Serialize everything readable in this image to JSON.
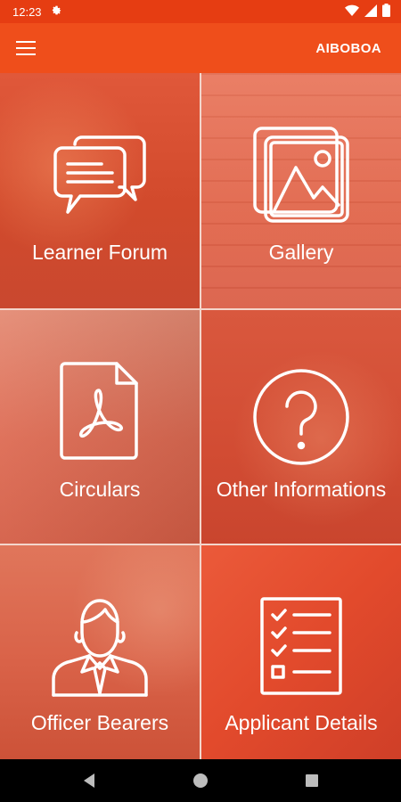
{
  "status_bar": {
    "time": "12:23",
    "icons": [
      "gear-icon",
      "wifi-icon",
      "signal-icon",
      "battery-icon"
    ]
  },
  "app_bar": {
    "title": "AIBOBOA",
    "menu_icon": "hamburger-menu-icon"
  },
  "tiles": [
    {
      "label": "Learner Forum",
      "icon": "chat-bubbles-icon"
    },
    {
      "label": "Gallery",
      "icon": "image-gallery-icon"
    },
    {
      "label": "Circulars",
      "icon": "pdf-document-icon"
    },
    {
      "label": "Other Informations",
      "icon": "question-circle-icon"
    },
    {
      "label": "Officer Bearers",
      "icon": "person-suit-icon"
    },
    {
      "label": "Applicant Details",
      "icon": "checklist-icon"
    }
  ],
  "colors": {
    "status_bar": "#e63d12",
    "app_bar": "#ef4e1b",
    "accent": "#ef4e1b"
  },
  "nav_bar": {
    "buttons": [
      "back-icon",
      "home-icon",
      "recents-icon"
    ]
  }
}
